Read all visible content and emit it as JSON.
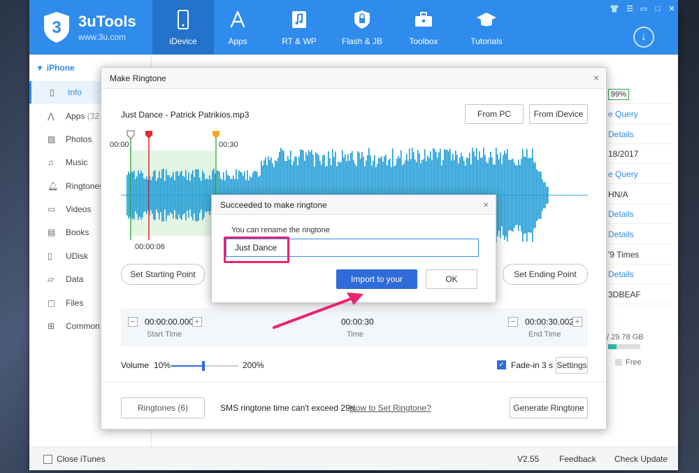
{
  "app": {
    "name": "3uTools",
    "url": "www.3u.com",
    "logo_digit": "3",
    "brand_color": "#2f8bec"
  },
  "nav": [
    {
      "label": "iDevice",
      "icon": "phone-icon",
      "active": true
    },
    {
      "label": "Apps",
      "icon": "appstore-icon"
    },
    {
      "label": "RT & WP",
      "icon": "music-note-icon"
    },
    {
      "label": "Flash & JB",
      "icon": "shield-icon"
    },
    {
      "label": "Toolbox",
      "icon": "toolbox-icon"
    },
    {
      "label": "Tutorials",
      "icon": "graduation-cap-icon"
    }
  ],
  "sidebar": {
    "device": "iPhone",
    "items": [
      {
        "label": "Info",
        "icon": "phone-info-icon",
        "active": true
      },
      {
        "label": "Apps",
        "count": "(32",
        "icon": "apps-icon"
      },
      {
        "label": "Photos",
        "icon": "photos-icon"
      },
      {
        "label": "Music",
        "icon": "music-icon"
      },
      {
        "label": "Ringtones",
        "icon": "bell-icon"
      },
      {
        "label": "Videos",
        "icon": "video-icon"
      },
      {
        "label": "Books",
        "icon": "books-icon"
      },
      {
        "label": "UDisk",
        "icon": "udisk-icon"
      },
      {
        "label": "Data",
        "icon": "folder-icon"
      },
      {
        "label": "Files",
        "icon": "files-icon"
      },
      {
        "label": "Common",
        "icon": "grid-icon"
      }
    ]
  },
  "info_column": {
    "battery": "99%",
    "rows": [
      "e Query",
      "Details",
      "18/2017",
      "e Query",
      "HN/A",
      "Details",
      "Details",
      "'9 Times",
      "Details",
      "3DBEAF"
    ],
    "storage_total": "/ 29.78 GB",
    "storage_used_fraction": 0.26,
    "free_label": "Free"
  },
  "dialog": {
    "title": "Make Ringtone",
    "close": "×",
    "file_name": "Just Dance - Patrick Patrikios.mp3",
    "from_pc": "From PC",
    "from_idevice": "From iDevice",
    "time_start_label": "00:00",
    "time_30_label": "00:30",
    "playhead_label": "00:00:06",
    "set_start": "Set Starting Point",
    "set_end": "Set Ending Point",
    "start_time_value": "00:00:00.000",
    "start_time_caption": "Start Time",
    "time_value": "00:00:30",
    "time_caption": "Time",
    "end_time_value": "00:00:30.002",
    "end_time_caption": "End Time",
    "minus": "−",
    "plus": "+",
    "volume_label": "Volume",
    "volume_min": "10%",
    "volume_max": "200%",
    "volume_level_fraction": 0.48,
    "fade_in_label": "Fade-in 3 s",
    "fade_in_checked": true,
    "settings_label": "Settings",
    "ringtones_button": "Ringtones (6)",
    "sms_note": "SMS ringtone time can't exceed 29s.",
    "how_to_link": "How to Set Ringtone?",
    "generate_button": "Generate Ringtone"
  },
  "popup": {
    "title": "Succeeded to make ringtone",
    "close": "×",
    "label": "You can rename the ringtone",
    "input_value": "Just Dance",
    "import_button": "Import to your iDevice",
    "ok_button": "OK"
  },
  "statusbar": {
    "close_itunes": "Close iTunes",
    "version": "V2.55",
    "feedback": "Feedback",
    "check_update": "Check Update"
  },
  "window_controls": [
    "shirt-icon",
    "menu-icon",
    "minimize-icon",
    "maximize-icon",
    "close-icon"
  ]
}
